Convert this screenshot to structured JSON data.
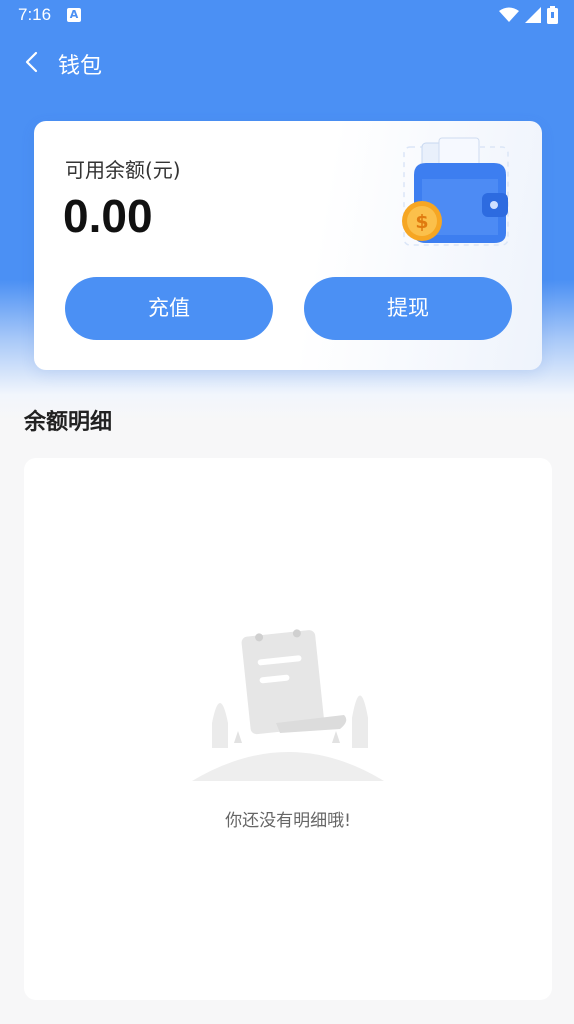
{
  "status_bar": {
    "time": "7:16",
    "notification_icon": "a-notification-icon"
  },
  "nav": {
    "title": "钱包",
    "back_icon": "chevron-left-icon"
  },
  "wallet": {
    "balance_label": "可用余额(元)",
    "balance_value": "0.00",
    "recharge_label": "充值",
    "withdraw_label": "提现",
    "illustration": "wallet-coin-icon"
  },
  "details": {
    "section_title": "余额明细",
    "empty_text": "你还没有明细哦!",
    "empty_illustration": "empty-receipt-icon"
  },
  "colors": {
    "primary": "#4b90f4",
    "background": "#f7f7f8",
    "card": "#ffffff"
  }
}
